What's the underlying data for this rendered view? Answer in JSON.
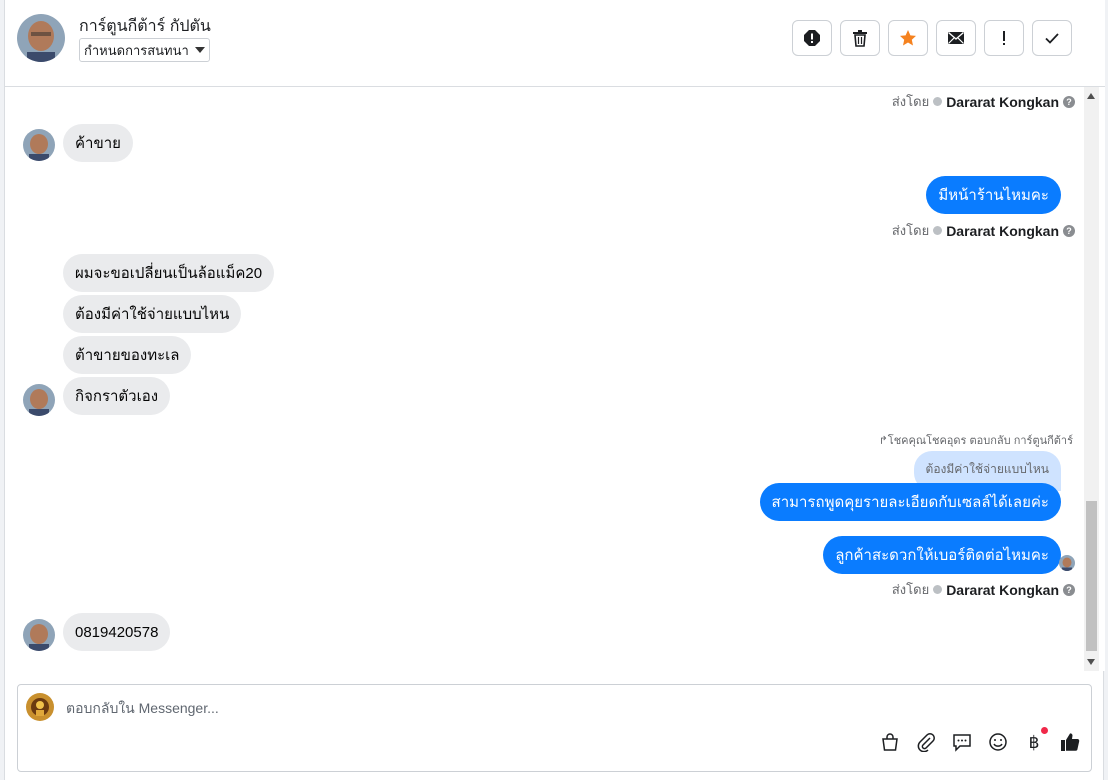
{
  "header": {
    "contact_name": "การ์ตูนกีต้าร์ กัปตัน",
    "assign_label": "กำหนดการสนทนา",
    "toolbar": [
      "spam-icon",
      "trash-icon",
      "star-icon",
      "mail-icon",
      "follow-up-icon",
      "done-icon"
    ]
  },
  "messages": [
    {
      "side": "meta",
      "sent_by_prefix": "ส่งโดย",
      "sent_by_name": "Dararat Kongkan"
    },
    {
      "side": "in",
      "text": "ค้าขาย"
    },
    {
      "side": "out",
      "text": "มีหน้าร้านไหมคะ"
    },
    {
      "side": "meta",
      "sent_by_prefix": "ส่งโดย",
      "sent_by_name": "Dararat Kongkan"
    },
    {
      "side": "in",
      "text": "ผมจะขอเปลี่ยนเป็นล้อแม็ค20"
    },
    {
      "side": "in",
      "text": "ต้องมีค่าใช้จ่ายแบบไหน"
    },
    {
      "side": "in",
      "text": "ต้าขายของทะเล"
    },
    {
      "side": "in",
      "text": "กิจกราตัวเอง"
    },
    {
      "side": "reply",
      "header": "โชคคุณโชคอุดร ตอบกลับ การ์ตูนกีต้าร์",
      "quoted": "ต้องมีค่าใช้จ่ายแบบไหน"
    },
    {
      "side": "out",
      "text": "สามารถพูดคุยรายละเอียดกับเซลล์ได้เลยค่ะ"
    },
    {
      "side": "out",
      "text": "ลูกค้าสะดวกให้เบอร์ติดต่อไหมคะ"
    },
    {
      "side": "meta",
      "sent_by_prefix": "ส่งโดย",
      "sent_by_name": "Dararat Kongkan"
    },
    {
      "side": "in",
      "text": "0819420578"
    }
  ],
  "composer": {
    "placeholder": "ตอบกลับใน Messenger...",
    "tools": [
      "bag-icon",
      "paperclip-icon",
      "saved-reply-icon",
      "emoji-icon",
      "baht-icon",
      "like-icon"
    ]
  },
  "colors": {
    "outgoing_bubble": "#0a7cff",
    "incoming_bubble": "#eaebed",
    "star": "#f5821f",
    "notification_dot": "#f02849"
  }
}
